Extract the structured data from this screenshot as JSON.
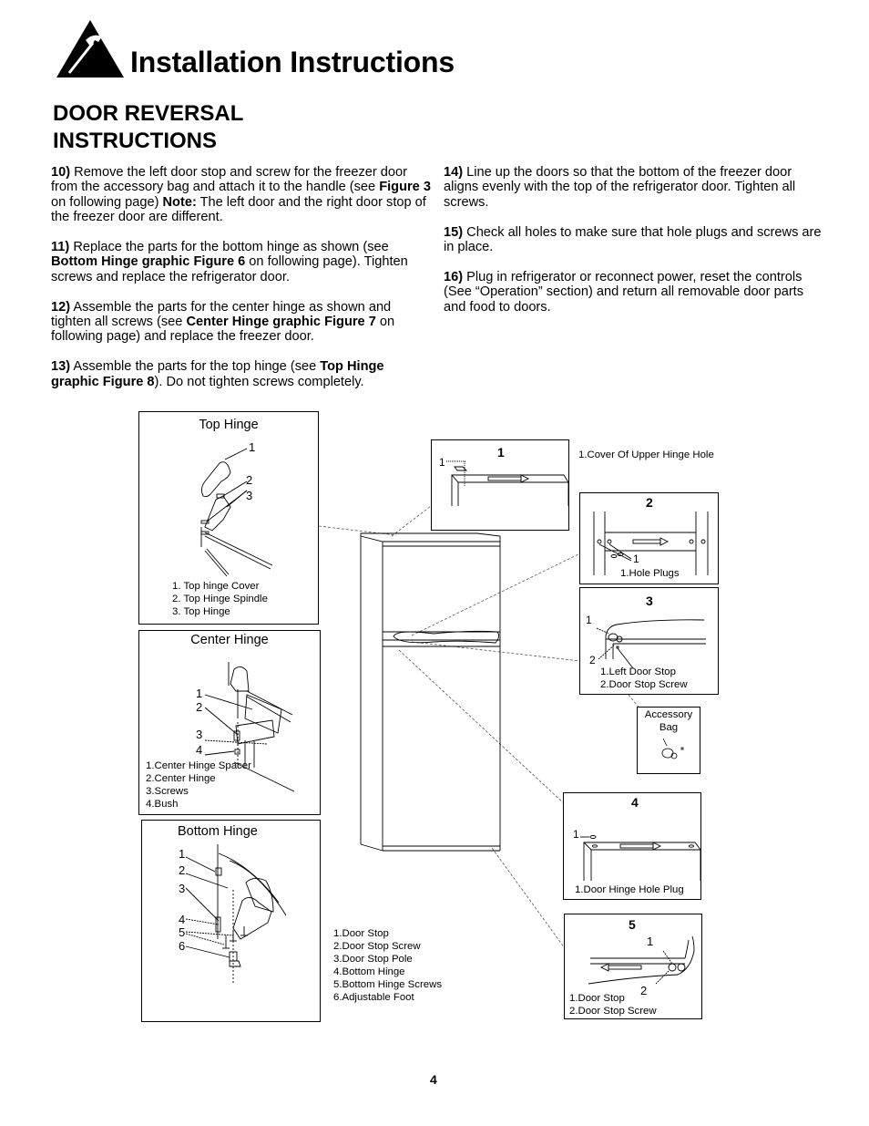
{
  "header": {
    "logo_icon": "hammer-warning-triangle-icon",
    "title": "Installation Instructions"
  },
  "section": {
    "title_line1": "DOOR REVERSAL",
    "title_line2": "INSTRUCTIONS"
  },
  "steps": [
    {
      "num": "10)",
      "parts": [
        {
          "t": " Remove the left door stop and screw for the freezer door from the accessory bag and attach it to the handle (see "
        },
        {
          "b": "Figure 3"
        },
        {
          "t": " on following page) "
        },
        {
          "b": "Note:"
        },
        {
          "t": " The left door and  the right door  stop of the freezer door are different."
        }
      ]
    },
    {
      "num": "11)",
      "parts": [
        {
          "t": " Replace the parts for the bottom hinge as shown (see "
        },
        {
          "b": "Bottom Hinge graphic Figure 6"
        },
        {
          "t": " on following page). Tighten screws and replace the refrigerator door."
        }
      ]
    },
    {
      "num": "12)",
      "parts": [
        {
          "t": " Assemble the parts for the center hinge as shown and tighten all screws (see "
        },
        {
          "b": "Center Hinge graphic Figure 7"
        },
        {
          "t": " on following page) and replace the freezer door."
        }
      ]
    },
    {
      "num": "13)",
      "parts": [
        {
          "t": " Assemble the parts for the top hinge (see "
        },
        {
          "b": "Top Hinge graphic Figure 8"
        },
        {
          "t": "). Do not tighten screws completely."
        }
      ]
    },
    {
      "num": "14)",
      "parts": [
        {
          "t": " Line up the doors so that the bottom of the freezer door aligns evenly with the top of the refrigerator door. Tighten all screws."
        }
      ]
    },
    {
      "num": "15)",
      "parts": [
        {
          "t": " Check all holes to make sure that hole plugs and screws are in place."
        }
      ]
    },
    {
      "num": "16)",
      "parts": [
        {
          "t": " Plug in refrigerator or reconnect power, reset the controls (See “Operation” section) and return all removable door parts and food to doors."
        }
      ]
    }
  ],
  "figures": {
    "top_hinge": {
      "title": "Top Hinge",
      "callouts": [
        "1",
        "2",
        "3"
      ],
      "legend": [
        "1. Top hinge Cover",
        "2. Top Hinge Spindle",
        "3. Top Hinge"
      ]
    },
    "center_hinge": {
      "title": "Center Hinge",
      "callouts": [
        "1",
        "2",
        "3",
        "4"
      ],
      "legend": [
        "1.Center Hinge Spacer",
        "2.Center Hinge",
        "3.Screws",
        "4.Bush"
      ]
    },
    "bottom_hinge": {
      "title": "Bottom Hinge",
      "callouts": [
        "1",
        "2",
        "3",
        "4",
        "5",
        "6"
      ],
      "legend": [
        "1.Door Stop",
        "2.Door Stop Screw",
        "3.Door Stop Pole",
        "4.Bottom Hinge",
        "5.Bottom Hinge Screws",
        "6.Adjustable Foot"
      ]
    },
    "detail_1": {
      "number": "1",
      "callout": "1",
      "legend": "1.Cover Of Upper Hinge Hole"
    },
    "detail_2": {
      "number": "2",
      "callout": "1",
      "legend": "1.Hole Plugs"
    },
    "detail_3": {
      "number": "3",
      "callouts": [
        "1",
        "2"
      ],
      "legend": [
        "1.Left Door Stop",
        "2.Door Stop Screw"
      ]
    },
    "accessory_bag": {
      "label_line1": "Accessory",
      "label_line2": "Bag"
    },
    "detail_4": {
      "number": "4",
      "callout": "1",
      "legend": "1.Door Hinge Hole Plug"
    },
    "detail_5": {
      "number": "5",
      "callouts": [
        "1",
        "2"
      ],
      "legend": [
        "1.Door Stop",
        "2.Door Stop Screw"
      ]
    }
  },
  "footer": {
    "page_number": "4"
  }
}
